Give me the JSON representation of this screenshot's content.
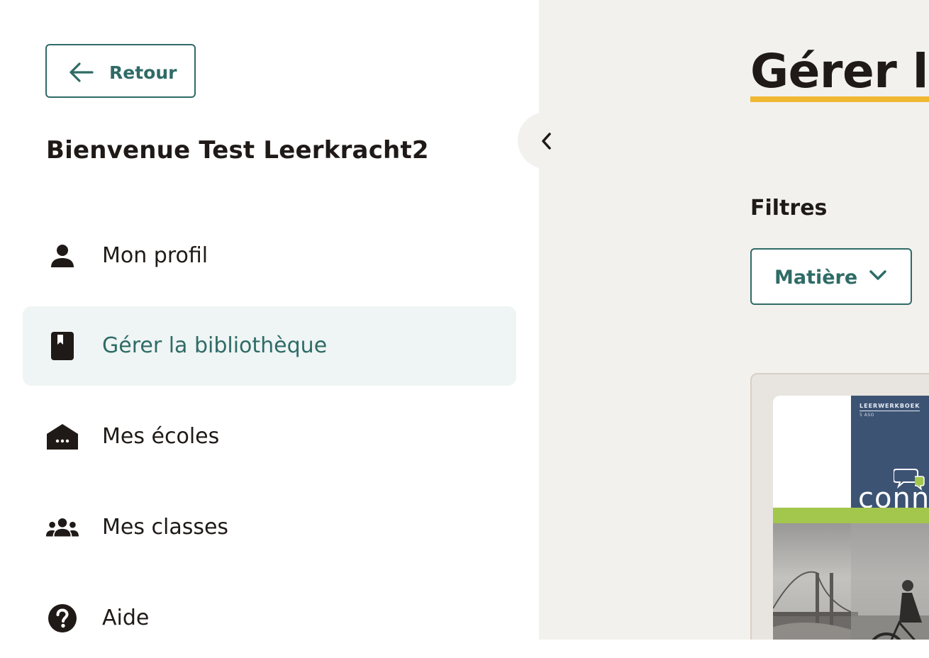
{
  "sidebar": {
    "back_button": {
      "label": "Retour",
      "icon": "arrow-left-icon"
    },
    "welcome": "Bienvenue Test Leerkracht2",
    "items": [
      {
        "label": "Mon profil",
        "icon": "person-icon",
        "active": false
      },
      {
        "label": "Gérer la bibliothèque",
        "icon": "book-icon",
        "active": true
      },
      {
        "label": "Mes écoles",
        "icon": "school-icon",
        "active": false
      },
      {
        "label": "Mes classes",
        "icon": "group-icon",
        "active": false
      },
      {
        "label": "Aide",
        "icon": "help-icon",
        "active": false
      }
    ],
    "collapse_icon": "chevron-left-icon"
  },
  "main": {
    "title": "Gérer la",
    "filters": {
      "heading": "Filtres",
      "subject_select": {
        "value": "Matière",
        "icon": "chevron-down-icon"
      }
    },
    "book": {
      "kicker": "LEERWERKBOEK",
      "level": "5 ASO",
      "series": "conn"
    }
  },
  "colors": {
    "accent": "#2f6b67",
    "title_underline": "#f0b732",
    "active_bg": "#eff5f4",
    "main_bg": "#f2f1ee",
    "text": "#1f1a17"
  }
}
